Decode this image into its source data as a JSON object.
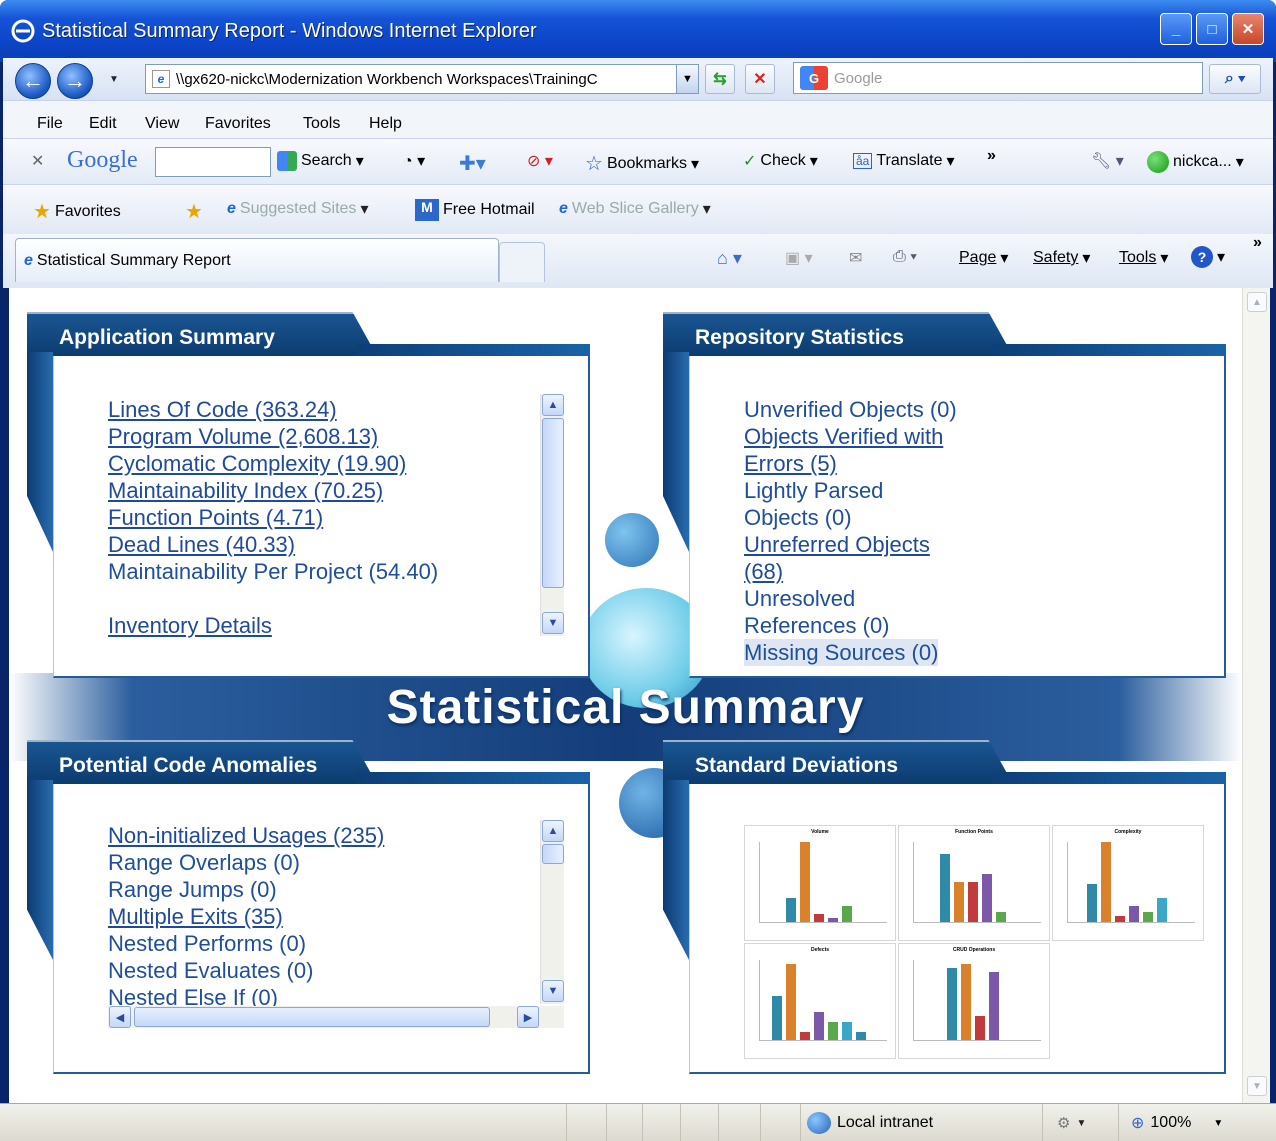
{
  "window": {
    "title": "Statistical Summary Report - Windows Internet Explorer"
  },
  "nav": {
    "address": "\\\\gx620-nickc\\Modernization Workbench Workspaces\\TrainingC",
    "search_placeholder": "Google"
  },
  "menu": [
    "File",
    "Edit",
    "View",
    "Favorites",
    "Tools",
    "Help"
  ],
  "google_toolbar": {
    "logo": "Google",
    "search_label": "Search",
    "bookmarks_label": "Bookmarks",
    "check_label": "Check",
    "translate_label": "Translate",
    "user_label": "nickca..."
  },
  "favorites_bar": {
    "favorites_label": "Favorites",
    "suggested_label": "Suggested Sites",
    "hotmail_label": "Free Hotmail",
    "webslice_label": "Web Slice Gallery"
  },
  "tabs": {
    "active_label": "Statistical Summary Report",
    "page_label": "Page",
    "safety_label": "Safety",
    "tools_label": "Tools"
  },
  "page": {
    "title": "Statistical Summary",
    "application_summary": {
      "heading": "Application Summary",
      "items": [
        {
          "text": "Lines Of Code (363.24)",
          "link": true
        },
        {
          "text": "Program Volume (2,608.13)",
          "link": true
        },
        {
          "text": "Cyclomatic Complexity (19.90)",
          "link": true
        },
        {
          "text": "Maintainability Index (70.25)",
          "link": true
        },
        {
          "text": "Function Points (4.71)",
          "link": true
        },
        {
          "text": "Dead Lines (40.33)",
          "link": true
        },
        {
          "text": "Maintainability Per Project (54.40)",
          "link": false
        }
      ],
      "inventory_link": "Inventory Details"
    },
    "repository_statistics": {
      "heading": "Repository Statistics",
      "items": [
        {
          "lines": [
            "Unverified Objects (0)"
          ],
          "link": false
        },
        {
          "lines": [
            "Objects Verified with",
            "Errors (5)"
          ],
          "link": true
        },
        {
          "lines": [
            "Lightly Parsed",
            "Objects (0)"
          ],
          "link": false
        },
        {
          "lines": [
            "Unreferred Objects",
            "(68)"
          ],
          "link": true
        },
        {
          "lines": [
            "Unresolved",
            "References (0)"
          ],
          "link": false
        },
        {
          "lines": [
            "Missing Sources (0)"
          ],
          "link": false,
          "highlighted": true
        }
      ]
    },
    "code_anomalies": {
      "heading": "Potential Code Anomalies",
      "items": [
        {
          "text": "Non-initialized Usages (235)",
          "link": true
        },
        {
          "text": "Range Overlaps (0)",
          "link": false
        },
        {
          "text": "Range Jumps (0)",
          "link": false
        },
        {
          "text": "Multiple Exits (35)",
          "link": true
        },
        {
          "text": "Nested Performs (0)",
          "link": false
        },
        {
          "text": "Nested Evaluates (0)",
          "link": false
        },
        {
          "text": "Nested Else If (0)",
          "link": false
        }
      ]
    },
    "standard_deviations": {
      "heading": "Standard Deviations",
      "charts": [
        "Volume",
        "Function Points",
        "Complexity",
        "Defects",
        "CRUD Operations"
      ]
    }
  },
  "status": {
    "zone": "Local intranet",
    "zoom": "100%"
  },
  "colors": {
    "link": "#1f4a9c",
    "panel_header": "#0c3c70",
    "title_bar": "#0b44c7",
    "bar_colors": [
      "#2e8aa6",
      "#d9822b",
      "#c23b3b",
      "#7d58a8",
      "#5aa84c",
      "#3aa7c9"
    ]
  },
  "chart_data": [
    {
      "type": "bar",
      "title": "Volume",
      "values": [
        0.3,
        1.0,
        0.1,
        0.05,
        0.2
      ],
      "note": "bars shown as relative heights"
    },
    {
      "type": "bar",
      "title": "Function Points",
      "values": [
        0.85,
        0.5,
        0.5,
        0.6,
        0.12
      ]
    },
    {
      "type": "bar",
      "title": "Complexity",
      "values": [
        0.48,
        1.0,
        0.08,
        0.2,
        0.12,
        0.3
      ]
    },
    {
      "type": "bar",
      "title": "Defects",
      "values": [
        0.55,
        0.95,
        0.1,
        0.35,
        0.23,
        0.23,
        0.1
      ]
    },
    {
      "type": "bar",
      "title": "CRUD Operations",
      "values": [
        0.9,
        0.95,
        0.3,
        0.85
      ]
    }
  ]
}
